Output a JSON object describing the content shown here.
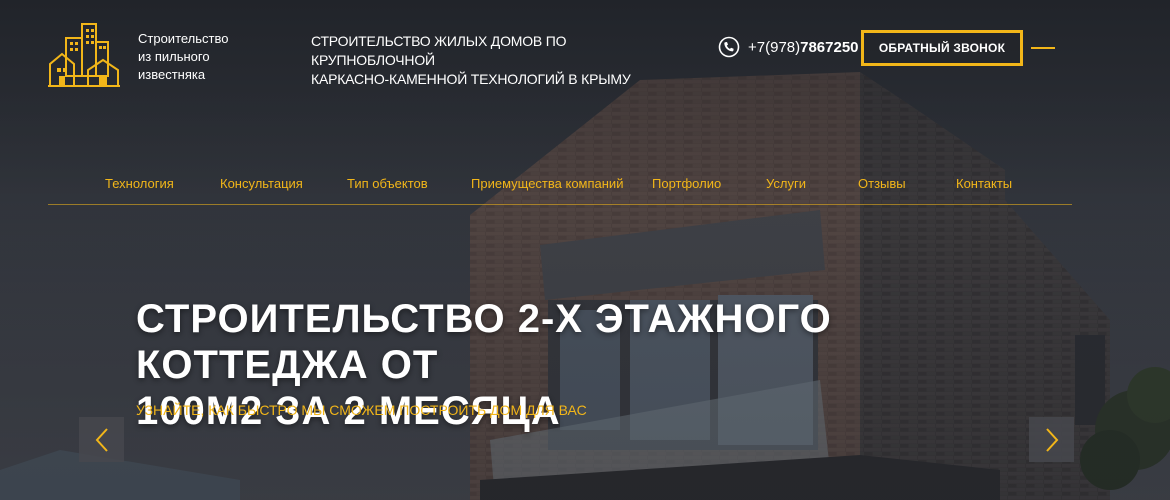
{
  "header": {
    "logo_lines": [
      "Строительство",
      "из пильного",
      "известняка"
    ],
    "tagline_lines": [
      "СТРОИТЕЛЬСТВО ЖИЛЫХ ДОМОВ ПО КРУПНОБЛОЧНОЙ",
      "КАРКАСНО-КАМЕННОЙ ТЕХНОЛОГИЙ В КРЫМУ"
    ],
    "phone_prefix": "+7(978)",
    "phone_number": "7867250",
    "callback_label": "ОБРАТНЫЙ ЗВОНОК"
  },
  "nav": {
    "items": [
      "Технология",
      "Консультация",
      "Тип объектов",
      "Приемущества компаний",
      "Портфолио",
      "Услуги",
      "Отзывы",
      "Контакты"
    ]
  },
  "hero": {
    "title_lines": [
      "СТРОИТЕЛЬСТВО 2-Х ЭТАЖНОГО КОТТЕДЖА ОТ",
      "100М2 ЗА 2 МЕСЯЦА"
    ],
    "subtitle": "УЗНАЙТЕ, КАК БЫСТРО МЫ СМОЖЕМ ПОСТРОИТЬ ДОМ ДЛЯ ВАС"
  },
  "icons": {
    "logo": "buildings-logo-icon",
    "phone": "phone-icon",
    "prev": "chevron-left-icon",
    "next": "chevron-right-icon",
    "menu": "menu-line-icon"
  },
  "colors": {
    "accent": "#f2b619",
    "text": "#ffffff",
    "background": "#2b2e34"
  }
}
